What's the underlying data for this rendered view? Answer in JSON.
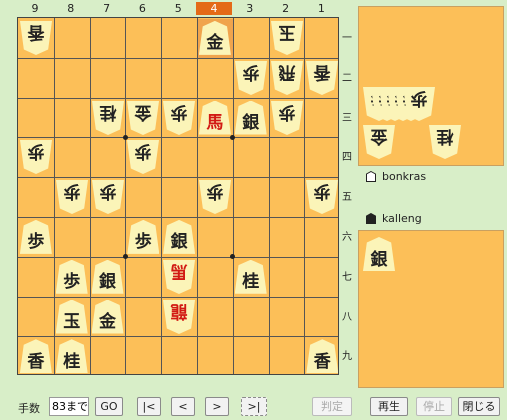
{
  "board": {
    "files": [
      "9",
      "8",
      "7",
      "6",
      "5",
      "4",
      "3",
      "2",
      "1"
    ],
    "ranks": [
      "一",
      "二",
      "三",
      "四",
      "五",
      "六",
      "七",
      "八",
      "九"
    ],
    "highlight_file": "4",
    "pieces": [
      {
        "file": 9,
        "rank": 1,
        "char": "香",
        "owner": "gote"
      },
      {
        "file": 4,
        "rank": 1,
        "char": "金",
        "owner": "sente",
        "last": true
      },
      {
        "file": 2,
        "rank": 1,
        "char": "玉",
        "owner": "gote"
      },
      {
        "file": 3,
        "rank": 2,
        "char": "歩",
        "owner": "gote"
      },
      {
        "file": 2,
        "rank": 2,
        "char": "飛",
        "owner": "gote"
      },
      {
        "file": 1,
        "rank": 2,
        "char": "香",
        "owner": "gote"
      },
      {
        "file": 7,
        "rank": 3,
        "char": "桂",
        "owner": "gote"
      },
      {
        "file": 6,
        "rank": 3,
        "char": "金",
        "owner": "gote"
      },
      {
        "file": 5,
        "rank": 3,
        "char": "歩",
        "owner": "gote"
      },
      {
        "file": 4,
        "rank": 3,
        "char": "馬",
        "owner": "sente",
        "red": true
      },
      {
        "file": 3,
        "rank": 3,
        "char": "銀",
        "owner": "sente"
      },
      {
        "file": 2,
        "rank": 3,
        "char": "歩",
        "owner": "gote"
      },
      {
        "file": 9,
        "rank": 4,
        "char": "歩",
        "owner": "gote"
      },
      {
        "file": 6,
        "rank": 4,
        "char": "歩",
        "owner": "gote"
      },
      {
        "file": 8,
        "rank": 5,
        "char": "歩",
        "owner": "gote"
      },
      {
        "file": 7,
        "rank": 5,
        "char": "歩",
        "owner": "gote"
      },
      {
        "file": 4,
        "rank": 5,
        "char": "歩",
        "owner": "gote"
      },
      {
        "file": 1,
        "rank": 5,
        "char": "歩",
        "owner": "gote"
      },
      {
        "file": 9,
        "rank": 6,
        "char": "歩",
        "owner": "sente"
      },
      {
        "file": 6,
        "rank": 6,
        "char": "歩",
        "owner": "sente"
      },
      {
        "file": 5,
        "rank": 6,
        "char": "銀",
        "owner": "sente"
      },
      {
        "file": 8,
        "rank": 7,
        "char": "歩",
        "owner": "sente"
      },
      {
        "file": 7,
        "rank": 7,
        "char": "銀",
        "owner": "sente"
      },
      {
        "file": 5,
        "rank": 7,
        "char": "馬",
        "owner": "gote",
        "red": true
      },
      {
        "file": 3,
        "rank": 7,
        "char": "桂",
        "owner": "sente"
      },
      {
        "file": 8,
        "rank": 8,
        "char": "玉",
        "owner": "sente"
      },
      {
        "file": 7,
        "rank": 8,
        "char": "金",
        "owner": "sente"
      },
      {
        "file": 5,
        "rank": 8,
        "char": "龍",
        "owner": "gote",
        "red": true
      },
      {
        "file": 9,
        "rank": 9,
        "char": "香",
        "owner": "sente"
      },
      {
        "file": 8,
        "rank": 9,
        "char": "桂",
        "owner": "sente"
      },
      {
        "file": 1,
        "rank": 9,
        "char": "香",
        "owner": "sente"
      }
    ]
  },
  "gote_hand": {
    "pieces": [
      {
        "char": "歩",
        "count": 6
      },
      {
        "char": "金",
        "count": 1
      },
      {
        "char": "桂",
        "count": 1
      }
    ]
  },
  "sente_hand": {
    "pieces": [
      {
        "char": "銀",
        "count": 1
      }
    ]
  },
  "players": {
    "gote": {
      "name": "bonkras",
      "mark": "white-pentagon"
    },
    "sente": {
      "name": "kalleng",
      "mark": "black-pentagon"
    }
  },
  "controls": {
    "move_label": "手数",
    "move_value": "83まで",
    "go": "GO",
    "first": "|<",
    "prev": "<",
    "next": ">",
    "last": ">|",
    "judge": "判定",
    "play": "再生",
    "stop": "停止",
    "close": "閉じる"
  }
}
